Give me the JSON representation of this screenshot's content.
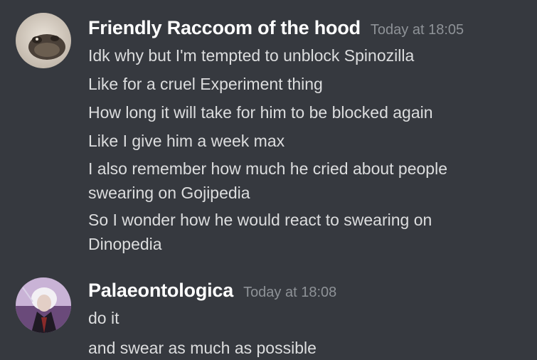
{
  "messages": [
    {
      "author": "Friendly Raccoom of the hood",
      "timestamp": "Today at 18:05",
      "avatar_icon": "raccoon-avatar-icon",
      "lines": [
        "Idk why but I'm tempted to unblock Spinozilla",
        "Like for a cruel Experiment thing",
        "How long it will take for him to be blocked again",
        "Like I give him a week max",
        "I also remember how much he cried about people swearing on Gojipedia",
        "So I wonder how he would react to swearing on Dinopedia"
      ]
    },
    {
      "author": "Palaeontologica",
      "timestamp": "Today at 18:08",
      "avatar_icon": "white-haired-character-avatar-icon",
      "lines": [
        "do it",
        "and swear as much as possible"
      ]
    }
  ],
  "colors": {
    "background": "#36393f",
    "username": "#ffffff",
    "message_text": "#dcddde",
    "timestamp": "#8e9297"
  }
}
